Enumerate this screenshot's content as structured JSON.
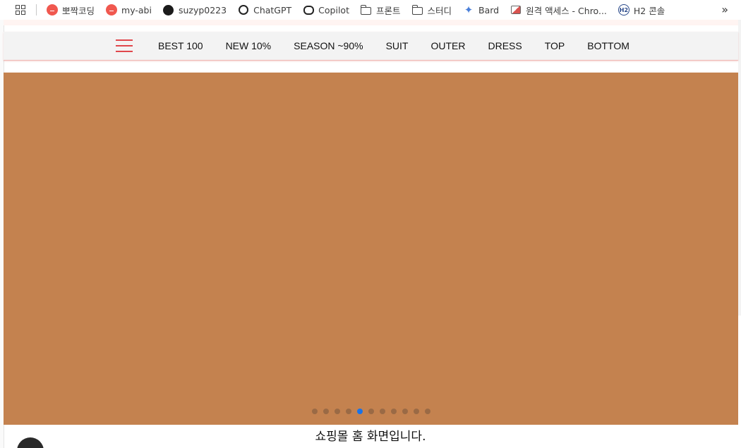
{
  "bookmarks": {
    "items": [
      {
        "label": "뽀짝코딩",
        "icon": "red-dot-icon"
      },
      {
        "label": "my-abi",
        "icon": "red-dot-icon"
      },
      {
        "label": "suzyp0223",
        "icon": "github-icon"
      },
      {
        "label": "ChatGPT",
        "icon": "chatgpt-icon"
      },
      {
        "label": "Copilot",
        "icon": "copilot-icon"
      },
      {
        "label": "프론트",
        "icon": "folder-icon"
      },
      {
        "label": "스터디",
        "icon": "folder-icon"
      },
      {
        "label": "Bard",
        "icon": "bard-icon"
      },
      {
        "label": "원격 액세스 - Chro...",
        "icon": "remote-access-icon"
      },
      {
        "label": "H2 콘솔",
        "icon": "h2-icon"
      }
    ],
    "more": "»"
  },
  "nav": {
    "menu": [
      "BEST 100",
      "NEW 10%",
      "SEASON ~90%",
      "SUIT",
      "OUTER",
      "DRESS",
      "TOP",
      "BOTTOM"
    ]
  },
  "slider": {
    "color": "#c4824f",
    "dot_count": 11,
    "active_index": 4
  },
  "caption": "쇼핑몰 홈 화면입니다."
}
